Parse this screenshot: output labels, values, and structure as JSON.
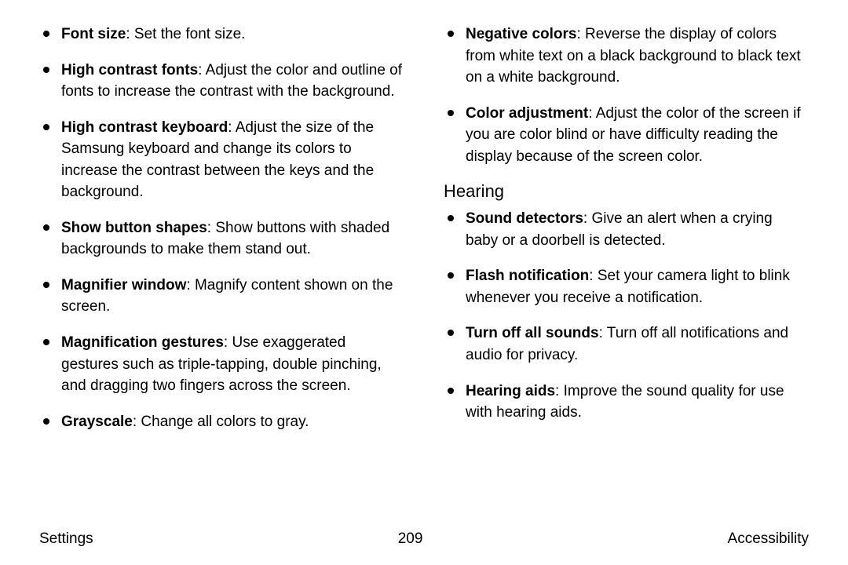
{
  "left_items": [
    {
      "term": "Font size",
      "desc": ": Set the font size."
    },
    {
      "term": "High contrast fonts",
      "desc": ": Adjust the color and outline of fonts to increase the contrast with the background."
    },
    {
      "term": "High contrast keyboard",
      "desc": ": Adjust the size of the Samsung keyboard and change its colors to increase the contrast between the keys and the background."
    },
    {
      "term": "Show button shapes",
      "desc": ": Show buttons with shaded backgrounds to make them stand out."
    },
    {
      "term": "Magnifier window",
      "desc": ": Magnify content shown on the screen."
    },
    {
      "term": "Magnification gestures",
      "desc": ": Use exaggerated gestures such as triple-tapping, double pinching, and dragging two fingers across the screen."
    },
    {
      "term": "Grayscale",
      "desc": ": Change all colors to gray."
    }
  ],
  "right_top_items": [
    {
      "term": "Negative colors",
      "desc": ": Reverse the display of colors from white text on a black background to black text on a white background."
    },
    {
      "term": "Color adjustment",
      "desc": ": Adjust the color of the screen if you are color blind or have difficulty reading the display because of the screen color."
    }
  ],
  "section_heading": "Hearing",
  "right_section_items": [
    {
      "term": "Sound detectors",
      "desc": ": Give an alert when a crying baby or a doorbell is detected."
    },
    {
      "term": "Flash notification",
      "desc": ": Set your camera light to blink whenever you receive a notification."
    },
    {
      "term": "Turn off all sounds",
      "desc": ": Turn off all notifications and audio for privacy."
    },
    {
      "term": "Hearing aids",
      "desc": ": Improve the sound quality for use with hearing aids."
    }
  ],
  "footer": {
    "left": "Settings",
    "center": "209",
    "right": "Accessibility"
  }
}
